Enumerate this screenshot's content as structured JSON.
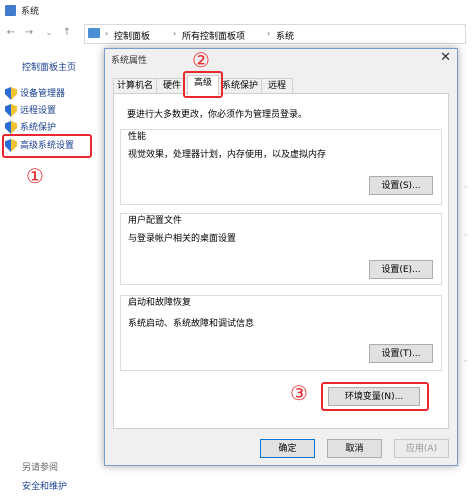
{
  "window": {
    "title": "系统"
  },
  "address": {
    "crumbs": [
      "控制面板",
      "所有控制面板项",
      "系统"
    ]
  },
  "sidebar": {
    "home": "控制面板主页",
    "items": [
      {
        "label": "设备管理器"
      },
      {
        "label": "远程设置"
      },
      {
        "label": "系统保护"
      },
      {
        "label": "高级系统设置"
      }
    ],
    "see_also": "另请参阅",
    "security": "安全和维护"
  },
  "annotations": {
    "n1": "①",
    "n2": "②",
    "n3": "③"
  },
  "dialog": {
    "title": "系统属性",
    "close": "✕",
    "tabs": [
      "计算机名",
      "硬件",
      "高级",
      "系统保护",
      "远程"
    ],
    "active_tab": "高级",
    "admin_note": "要进行大多数更改，你必须作为管理员登录。",
    "groups": [
      {
        "title": "性能",
        "desc": "视觉效果，处理器计划，内存使用，以及虚拟内存",
        "button": "设置(S)..."
      },
      {
        "title": "用户配置文件",
        "desc": "与登录帐户相关的桌面设置",
        "button": "设置(E)..."
      },
      {
        "title": "启动和故障恢复",
        "desc": "系统启动、系统故障和调试信息",
        "button": "设置(T)..."
      }
    ],
    "env_button": "环境变量(N)...",
    "ok": "确定",
    "cancel": "取消",
    "apply": "应用(A)"
  },
  "colors": {
    "annotation": "#e8272e",
    "link": "#1a3f8f",
    "accent": "#0078d7"
  }
}
